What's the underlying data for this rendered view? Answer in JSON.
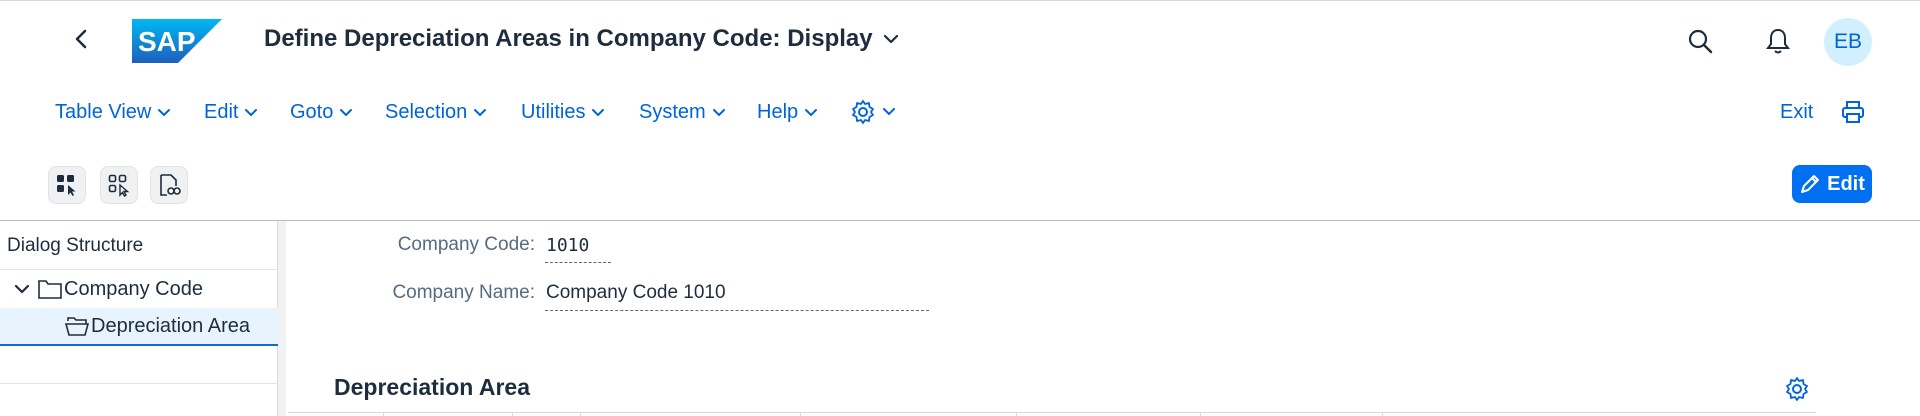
{
  "shell": {
    "title": "Define Depreciation Areas in Company Code: Display",
    "avatar_initials": "EB",
    "logo_text": "SAP"
  },
  "menu": {
    "items": [
      "Table View",
      "Edit",
      "Goto",
      "Selection",
      "Utilities",
      "System",
      "Help"
    ],
    "exit_label": "Exit"
  },
  "toolbar": {
    "edit_label": "Edit"
  },
  "dialog": {
    "title": "Dialog Structure",
    "tree": [
      {
        "label": "Company Code"
      },
      {
        "label": "Depreciation Area"
      }
    ]
  },
  "form": {
    "company_code_label": "Company Code:",
    "company_code_value": "1010",
    "company_name_label": "Company Name:",
    "company_name_value": "Company Code 1010"
  },
  "section": {
    "title": "Depreciation Area"
  },
  "colors": {
    "accent": "#0064d9",
    "button": "#0070f2",
    "selected_row": "#e8f4fd"
  }
}
